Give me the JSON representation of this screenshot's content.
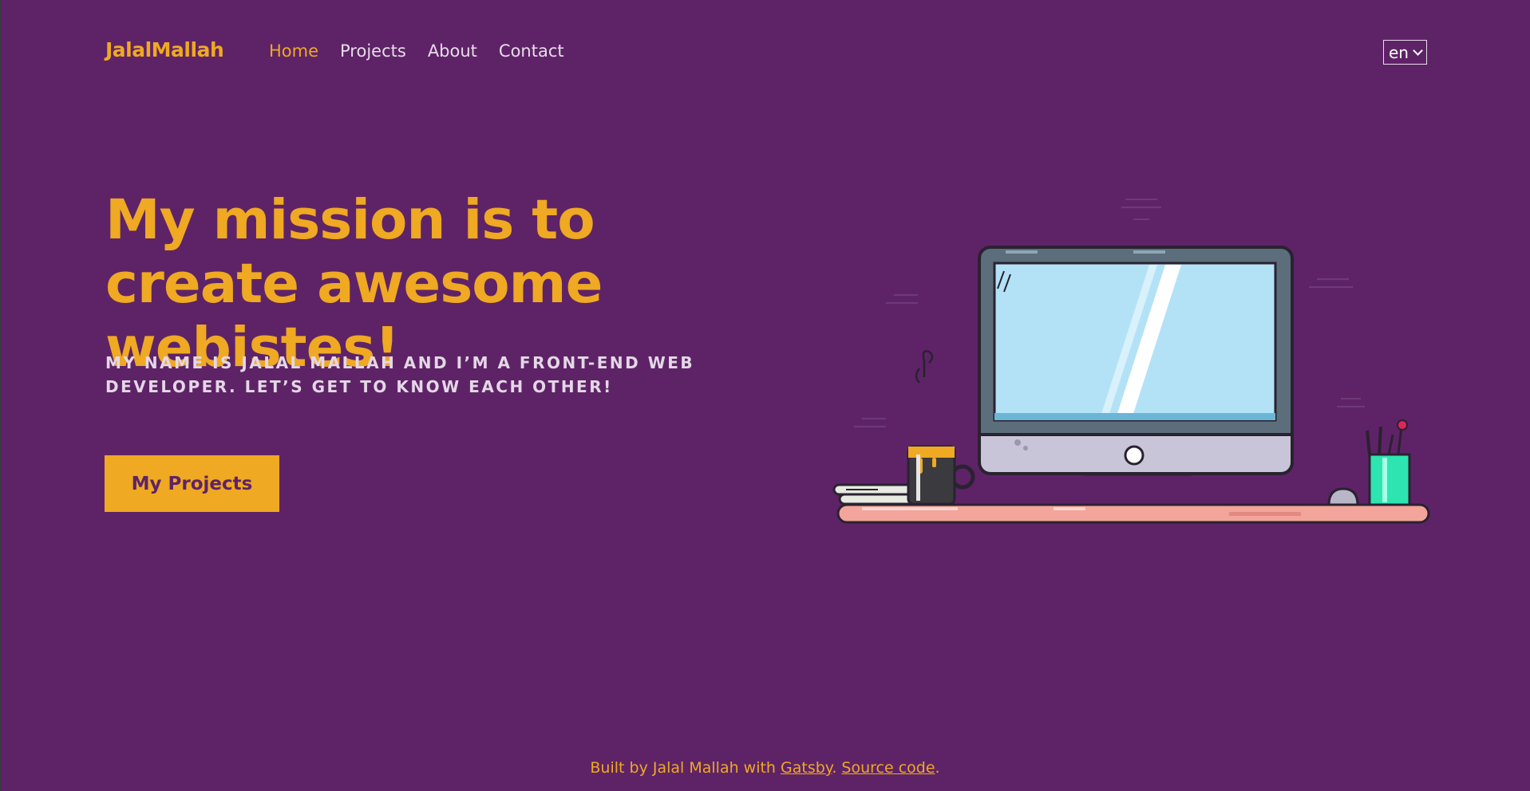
{
  "header": {
    "logo": "JalalMallah",
    "nav": [
      {
        "label": "Home",
        "active": true
      },
      {
        "label": "Projects",
        "active": false
      },
      {
        "label": "About",
        "active": false
      },
      {
        "label": "Contact",
        "active": false
      }
    ],
    "language": "en"
  },
  "hero": {
    "title": "My mission is to create awesome webistes!",
    "subtitle": "My name is Jalal Mallah and I’m a front-end web developer. Let’s get to know each other!",
    "cta_label": "My Projects"
  },
  "footer": {
    "prefix": "Built by Jalal Mallah with ",
    "gatsby_link": "Gatsby",
    "separator": ". ",
    "source_link": "Source code",
    "suffix": "."
  },
  "colors": {
    "background": "#5e2367",
    "accent": "#efa922",
    "text_light": "#e8dde9"
  },
  "illustration": {
    "icons": [
      "desk-icon",
      "monitor-icon",
      "coffee-mug-icon",
      "books-icon",
      "pencil-cup-icon",
      "mouse-icon"
    ]
  }
}
